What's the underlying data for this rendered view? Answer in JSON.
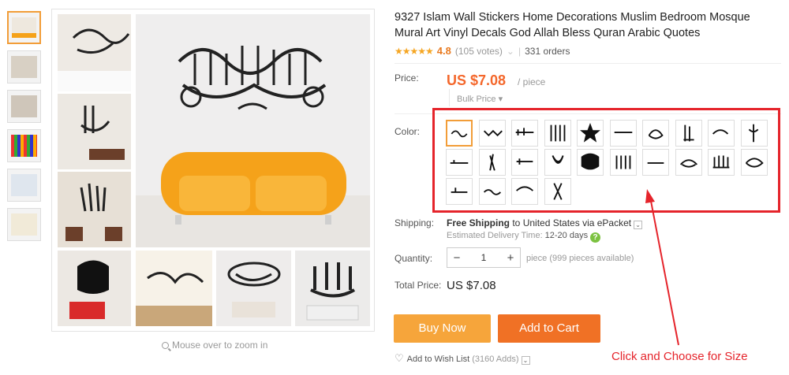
{
  "product": {
    "title": "9327 Islam Wall Stickers Home Decorations Muslim Bedroom Mosque Mural Art Vinyl Decals God Allah Bless Quran Arabic Quotes",
    "rating_value": "4.8",
    "rating_stars": "★★★★★",
    "votes": "(105 votes)",
    "orders": "331 orders"
  },
  "price": {
    "label": "Price:",
    "value": "US $7.08",
    "unit": "/ piece",
    "bulk": "Bulk Price ▾"
  },
  "color": {
    "label": "Color:",
    "selected_index": 0,
    "swatch_count": 24
  },
  "shipping": {
    "label": "Shipping:",
    "free": "Free Shipping",
    "to_text": " to United States via ePacket",
    "est_label": "Estimated Delivery Time:",
    "est_days": "12-20 days"
  },
  "quantity": {
    "label": "Quantity:",
    "minus": "−",
    "value": "1",
    "plus": "+",
    "available": "piece (999 pieces available)"
  },
  "total": {
    "label": "Total Price:",
    "value": "US $7.08"
  },
  "actions": {
    "buy_now": "Buy Now",
    "add_to_cart": "Add to Cart",
    "wishlist": "Add to Wish List",
    "wishlist_count": "(3160 Adds)"
  },
  "gallery": {
    "zoom_hint": "Mouse over to zoom in"
  },
  "annotation": {
    "text": "Click and Choose for Size",
    "color": "#e5242b"
  },
  "colors": {
    "accent": "#f4672b",
    "buy_button": "#f6a53b",
    "cart_button": "#f07125",
    "star": "#f5a623",
    "sofa": "#f5a21a"
  }
}
